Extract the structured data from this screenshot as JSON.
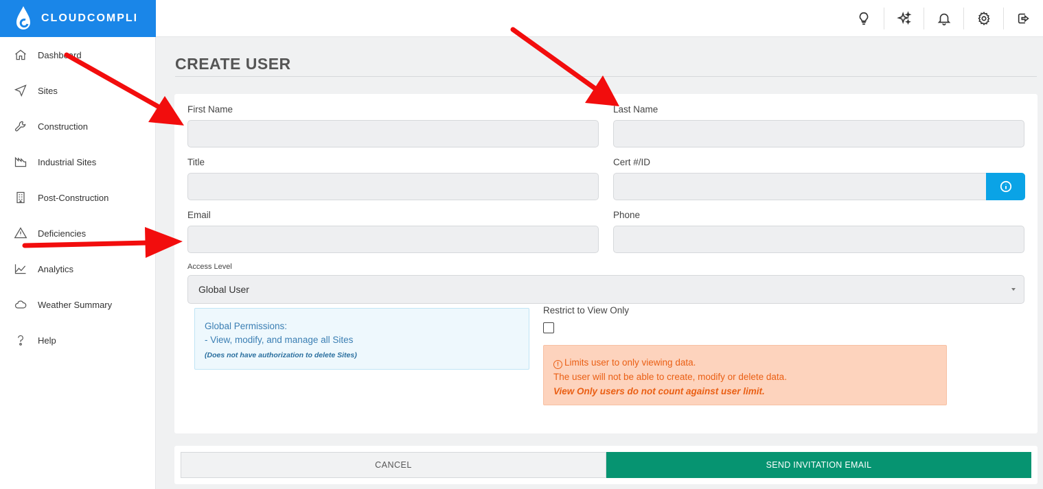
{
  "brand": {
    "name": "CLOUDCOMPLI",
    "color": "#1a86e8"
  },
  "topbar": {
    "icons": [
      "lightbulb-icon",
      "sparkles-icon",
      "bell-icon",
      "gear-icon",
      "logout-icon"
    ]
  },
  "sidebar": {
    "items": [
      {
        "label": "Dashboard",
        "icon": "home-icon"
      },
      {
        "label": "Sites",
        "icon": "navigation-icon"
      },
      {
        "label": "Construction",
        "icon": "wrench-icon"
      },
      {
        "label": "Industrial Sites",
        "icon": "factory-icon"
      },
      {
        "label": "Post-Construction",
        "icon": "building-icon"
      },
      {
        "label": "Deficiencies",
        "icon": "warning-icon"
      },
      {
        "label": "Analytics",
        "icon": "area-chart-icon"
      },
      {
        "label": "Weather Summary",
        "icon": "cloud-icon"
      },
      {
        "label": "Help",
        "icon": "question-icon"
      }
    ]
  },
  "page": {
    "title": "CREATE USER"
  },
  "form": {
    "first_name": {
      "label": "First Name",
      "value": ""
    },
    "last_name": {
      "label": "Last Name",
      "value": ""
    },
    "title": {
      "label": "Title",
      "value": ""
    },
    "cert_id": {
      "label": "Cert #/ID",
      "value": ""
    },
    "email": {
      "label": "Email",
      "value": ""
    },
    "phone": {
      "label": "Phone",
      "value": ""
    },
    "access_level": {
      "label": "Access Level",
      "value": "Global User"
    },
    "restrict": {
      "label": "Restrict to View Only",
      "checked": false
    }
  },
  "permissions": {
    "line1": "Global Permissions:",
    "line2": "- View, modify, and manage all Sites",
    "note": "(Does not have authorization to delete Sites)"
  },
  "warning": {
    "line1": "Limits user to only viewing data.",
    "line2": "The user will not be able to create, modify or delete data.",
    "line3": "View Only users do not count against user limit."
  },
  "actions": {
    "cancel": "CANCEL",
    "send": "SEND INVITATION EMAIL"
  },
  "colors": {
    "primary_green": "#069471",
    "info_blue": "#0aa3e6",
    "warning_orange": "#ea5f14",
    "annotation_red": "#f20d0d"
  }
}
